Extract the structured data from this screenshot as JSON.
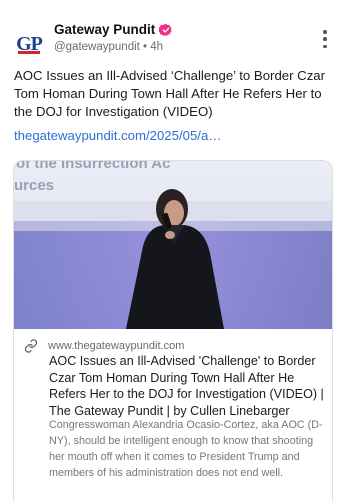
{
  "post": {
    "author": {
      "name": "Gateway Pundit",
      "handle": "@gatewaypundit",
      "time": "4h",
      "avatar_text": "GP"
    },
    "colors": {
      "accent_link": "#2f6fd6",
      "verified_badge": "#e8308a",
      "avatar_blue": "#1f3f8f",
      "avatar_red": "#d6242c"
    },
    "text": "AOC Issues an Ill-Advised ‘Challenge’ to Border Czar Tom Homan During Town Hall After He Refers Her to the DOJ for Investigation (VIDEO)",
    "link_text": "thegatewaypundit.com/2025/05/a…",
    "menu_icon": "more-vertical-icon"
  },
  "card": {
    "thumbnail": {
      "overlay_line1": "of the Insurrection Ac",
      "overlay_line2": "urces"
    },
    "domain": "www.thegatewaypundit.com",
    "domain_icon": "link-icon",
    "title": "AOC Issues an Ill-Advised 'Challenge' to Border Czar Tom Homan During Town Hall After He Refers Her to the DOJ for Investigation (VIDEO) | The Gateway Pundit | by Cullen Linebarger",
    "description": "Congresswoman Alexandria Ocasio-Cortez, aka AOC (D-NY), should be intelligent enough to know that shooting her mouth off when it comes to President Trump and members of his administration does not end well."
  }
}
